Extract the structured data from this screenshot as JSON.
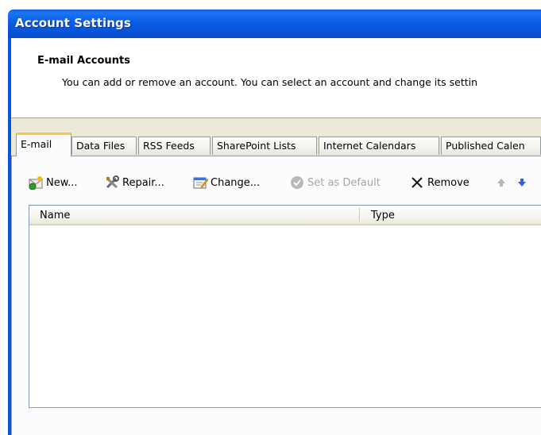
{
  "window": {
    "title": "Account Settings"
  },
  "header": {
    "title": "E-mail Accounts",
    "description": "You can add or remove an account. You can select an account and change its settin"
  },
  "tabs": [
    {
      "label": "E-mail",
      "active": true
    },
    {
      "label": "Data Files",
      "active": false
    },
    {
      "label": "RSS Feeds",
      "active": false
    },
    {
      "label": "SharePoint Lists",
      "active": false
    },
    {
      "label": "Internet Calendars",
      "active": false
    },
    {
      "label": "Published Calen",
      "active": false
    }
  ],
  "toolbar": {
    "new_label": "New...",
    "repair_label": "Repair...",
    "change_label": "Change...",
    "set_default_label": "Set as Default",
    "remove_label": "Remove",
    "icons": [
      "new-mail-icon",
      "repair-tools-icon",
      "change-settings-icon",
      "check-icon",
      "remove-x-icon",
      "move-up-arrow-icon",
      "move-down-arrow-icon"
    ]
  },
  "list": {
    "columns": [
      "Name",
      "Type"
    ],
    "rows": []
  },
  "colors": {
    "titlebar": "#0a5fe0",
    "active_tab_accent": "#ffc83c",
    "dialog_bg": "#ece9d8",
    "disabled_text": "#a5a5a5"
  }
}
